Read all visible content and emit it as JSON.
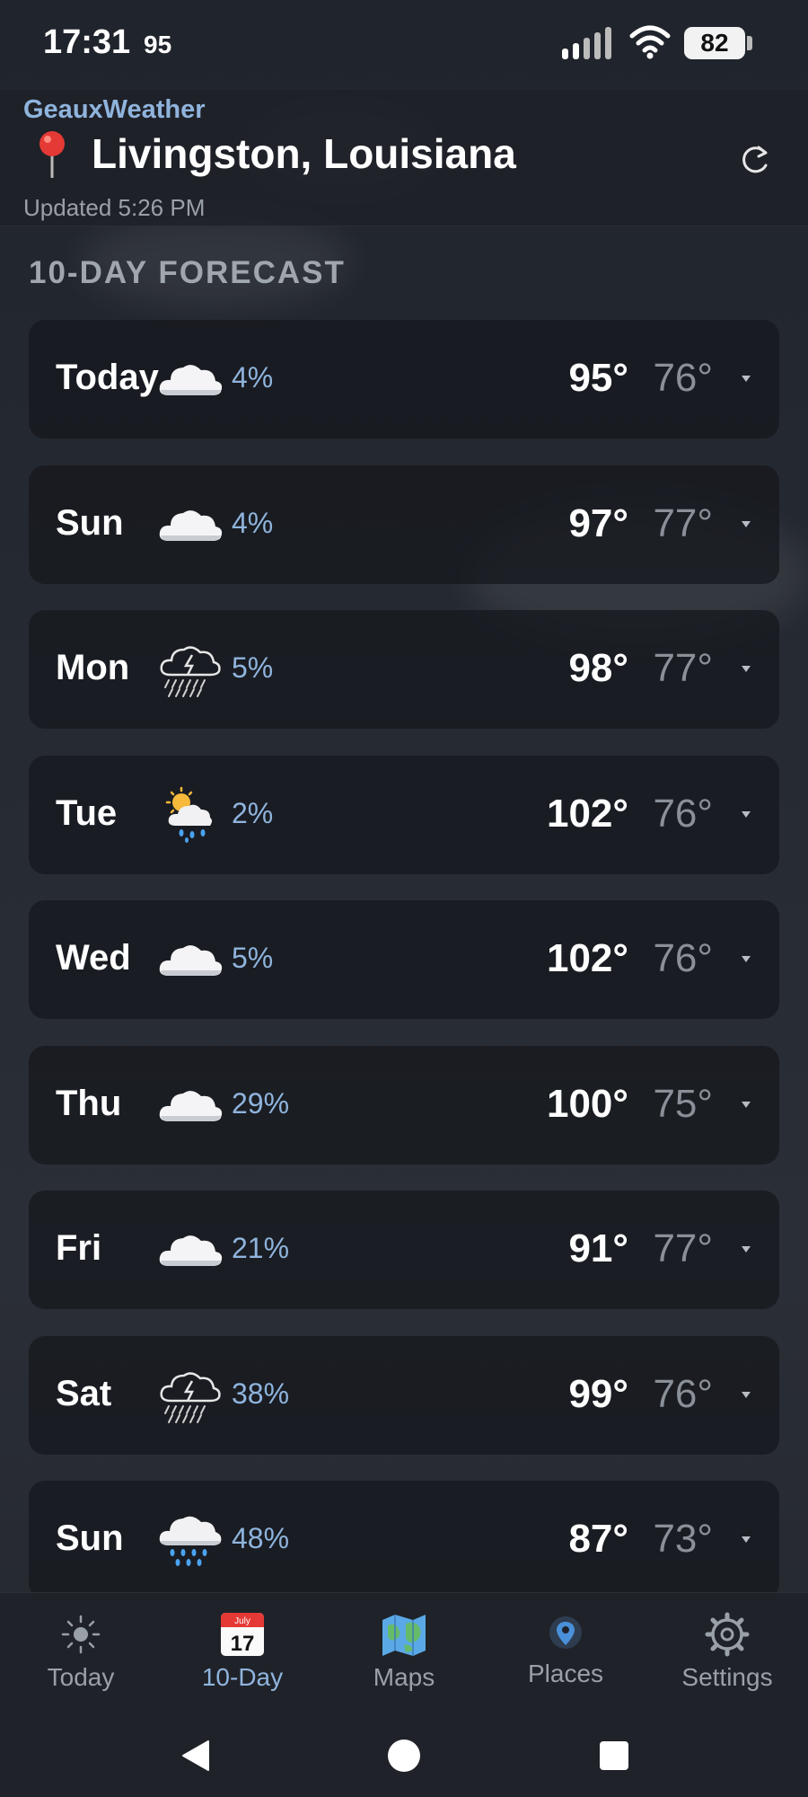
{
  "status_bar": {
    "time": "17:31",
    "temp": "95",
    "battery": "82"
  },
  "header": {
    "app_name": "GeauxWeather",
    "location": "Livingston, Louisiana",
    "updated": "Updated 5:26 PM"
  },
  "section_title": "10-DAY FORECAST",
  "forecast": [
    {
      "day": "Today",
      "icon": "cloud-icon",
      "pop": "4%",
      "high": "95°",
      "low": "76°"
    },
    {
      "day": "Sun",
      "icon": "cloud-icon",
      "pop": "4%",
      "high": "97°",
      "low": "77°"
    },
    {
      "day": "Mon",
      "icon": "thunderstorm-icon",
      "pop": "5%",
      "high": "98°",
      "low": "77°"
    },
    {
      "day": "Tue",
      "icon": "sun-rain-icon",
      "pop": "2%",
      "high": "102°",
      "low": "76°"
    },
    {
      "day": "Wed",
      "icon": "cloud-icon",
      "pop": "5%",
      "high": "102°",
      "low": "76°"
    },
    {
      "day": "Thu",
      "icon": "cloud-icon",
      "pop": "29%",
      "high": "100°",
      "low": "75°"
    },
    {
      "day": "Fri",
      "icon": "cloud-icon",
      "pop": "21%",
      "high": "91°",
      "low": "77°"
    },
    {
      "day": "Sat",
      "icon": "thunderstorm-icon",
      "pop": "38%",
      "high": "99°",
      "low": "76°"
    },
    {
      "day": "Sun",
      "icon": "rain-cloud-icon",
      "pop": "48%",
      "high": "87°",
      "low": "73°"
    }
  ],
  "nav": {
    "today": "Today",
    "ten_day": "10-Day",
    "calendar_month": "July",
    "calendar_day": "17",
    "maps": "Maps",
    "places": "Places",
    "settings": "Settings",
    "active": "10-Day"
  },
  "colors": {
    "accent": "#8fb4dd",
    "background": "#23262d",
    "card": "#16181e",
    "low_temp": "#8a8f98"
  }
}
